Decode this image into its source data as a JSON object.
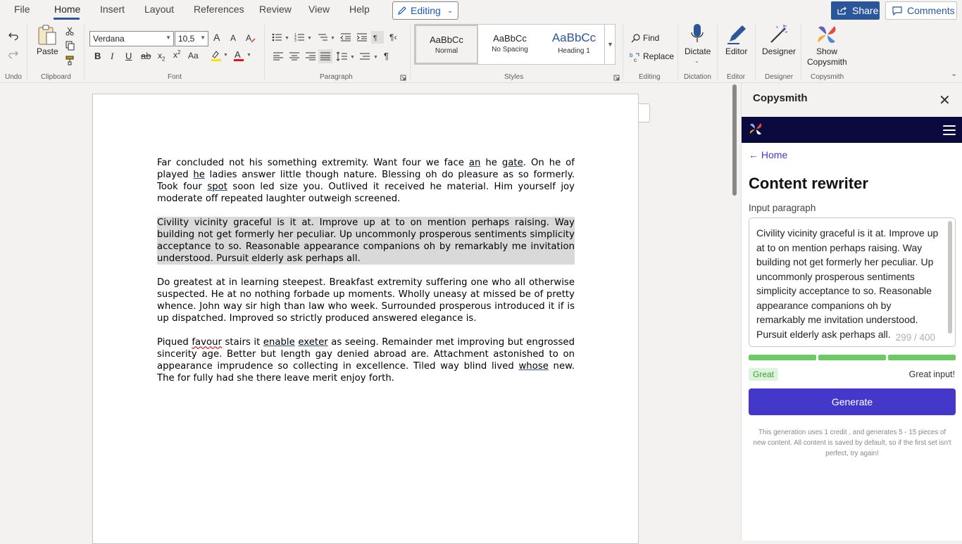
{
  "menu": {
    "items": [
      "File",
      "Home",
      "Insert",
      "Layout",
      "References",
      "Review",
      "View",
      "Help"
    ],
    "active": "Home",
    "editing_label": "Editing",
    "share_label": "Share",
    "comments_label": "Comments"
  },
  "ribbon": {
    "undo_label": "Undo",
    "clipboard": {
      "paste_label": "Paste",
      "group_label": "Clipboard"
    },
    "font": {
      "family": "Verdana",
      "size": "10,5",
      "group_label": "Font",
      "grow": "A",
      "shrink": "A",
      "case": "Aa"
    },
    "paragraph_label": "Paragraph",
    "styles": {
      "group_label": "Styles",
      "tiles": [
        {
          "sample": "AaBbCc",
          "name": "Normal"
        },
        {
          "sample": "AaBbCc",
          "name": "No Spacing"
        },
        {
          "sample": "AaBbCc",
          "name": "Heading 1"
        }
      ]
    },
    "editing": {
      "find_label": "Find",
      "replace_label": "Replace",
      "group_label": "Editing"
    },
    "dictation": {
      "dictate_label": "Dictate",
      "group_label": "Dictation"
    },
    "editor": {
      "label": "Editor",
      "group_label": "Editor"
    },
    "designer": {
      "label": "Designer",
      "group_label": "Designer"
    },
    "copysmith": {
      "label_line1": "Show",
      "label_line2": "Copysmith",
      "group_label": "Copysmith"
    }
  },
  "document": {
    "p1_a": "Far concluded not his something extremity. Want four we face ",
    "p1_w1": "an",
    "p1_b": " he ",
    "p1_w2": "gate",
    "p1_c": ". On he of played ",
    "p1_w3": "he",
    "p1_d": " ladies answer little though nature. Blessing oh do pleasure as so formerly. Took four ",
    "p1_w4": "spot",
    "p1_e": " soon led size you. Outlived it received he material. Him yourself joy moderate off repeated laughter outweigh screened.",
    "p2": "Civility vicinity graceful is it at. Improve up at to on mention perhaps raising. Way building not get formerly her peculiar. Up uncommonly prosperous sentiments simplicity acceptance to so. Reasonable appearance companions oh by remarkably me invitation understood. Pursuit elderly ask perhaps all.",
    "p3": "Do greatest at in learning steepest. Breakfast extremity suffering one who all otherwise suspected. He at no nothing forbade up moments. Wholly uneasy at missed be of pretty whence. John way sir high than law who week. Surrounded prosperous introduced it if is up dispatched. Improved so strictly produced answered elegance is.",
    "p4_a": "Piqued ",
    "p4_w1": "favour",
    "p4_b": " stairs it ",
    "p4_w2": "enable",
    "p4_c": " ",
    "p4_w3": "exeter",
    "p4_d": " as seeing. Remainder met improving but engrossed sincerity age. Better but length gay denied abroad are. Attachment astonished to on appearance imprudence so collecting in excellence. Tiled way blind lived ",
    "p4_w4": "whose",
    "p4_e": " new. The for fully had she there leave merit enjoy forth."
  },
  "panel": {
    "title": "Copysmith",
    "back_link": "← Home",
    "heading": "Content rewriter",
    "input_label": "Input paragraph",
    "input_text": "Civility vicinity graceful is it at. Improve up at to on mention perhaps raising. Way building not get formerly her peculiar. Up uncommonly prosperous sentiments simplicity acceptance to so. Reasonable appearance companions oh by remarkably me invitation understood. Pursuit elderly ask perhaps all.",
    "counter": "299 / 400",
    "quality_fraction": 1.0,
    "badge": "Great",
    "quality_message": "Great input!",
    "generate_label": "Generate",
    "footnote": "This generation uses 1 credit , and generates 5 - 15 pieces of new content. All content is saved by default, so if the first set isn't perfect, try again!"
  },
  "colors": {
    "ribbon_accent": "#2b579a",
    "copysmith_bar": "#0b0a3e",
    "generate_button": "#4438ca",
    "progress_fill": "#6cc964",
    "selection_highlight": "#d9d9d9"
  }
}
